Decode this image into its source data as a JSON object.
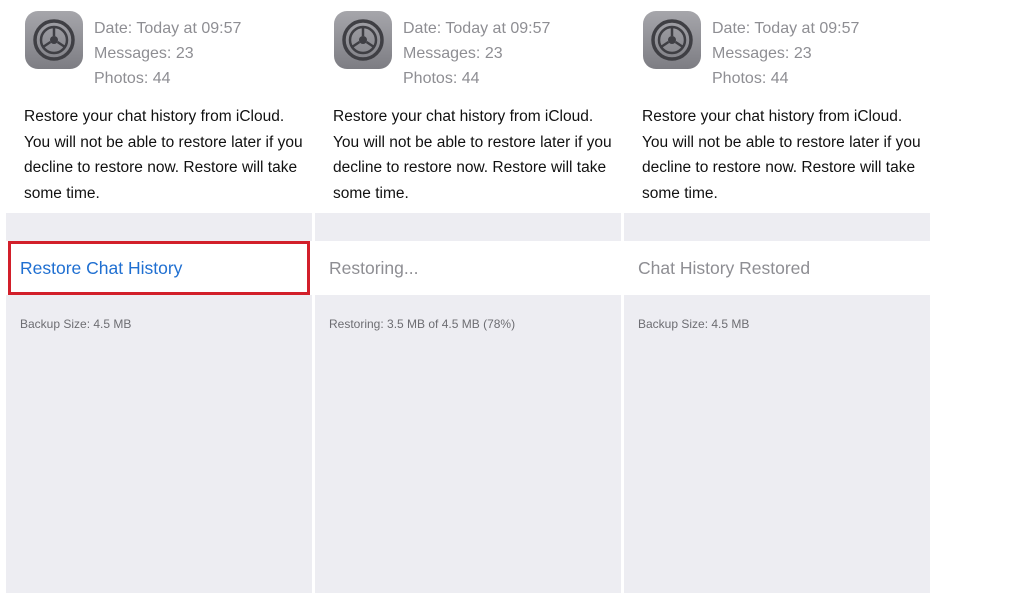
{
  "panels": [
    {
      "icon": "settings-gear-icon",
      "date": "Date: Today at 09:57",
      "messages": "Messages: 23",
      "photos": "Photos: 44",
      "description": "Restore your chat history from iCloud. You will not be able to restore later if you decline to restore now. Restore will take some time.",
      "action_label": "Restore Chat History",
      "action_state": "link",
      "footnote": "Backup Size: 4.5 MB"
    },
    {
      "icon": "settings-gear-icon",
      "date": "Date: Today at 09:57",
      "messages": "Messages: 23",
      "photos": "Photos: 44",
      "description": "Restore your chat history from iCloud. You will not be able to restore later if you decline to restore now. Restore will take some time.",
      "action_label": "Restoring...",
      "action_state": "disabled",
      "footnote": "Restoring: 3.5 MB of 4.5 MB (78%)"
    },
    {
      "icon": "settings-gear-icon",
      "date": "Date: Today at 09:57",
      "messages": "Messages: 23",
      "photos": "Photos: 44",
      "description": "Restore your chat history from iCloud. You will not be able to restore later if you decline to restore now. Restore will take some time.",
      "action_label": "Chat History Restored",
      "action_state": "disabled",
      "footnote": "Backup Size: 4.5 MB"
    }
  ],
  "colors": {
    "link": "#1f6fd1",
    "highlight": "#d21f2a",
    "background": "#ededf2"
  }
}
